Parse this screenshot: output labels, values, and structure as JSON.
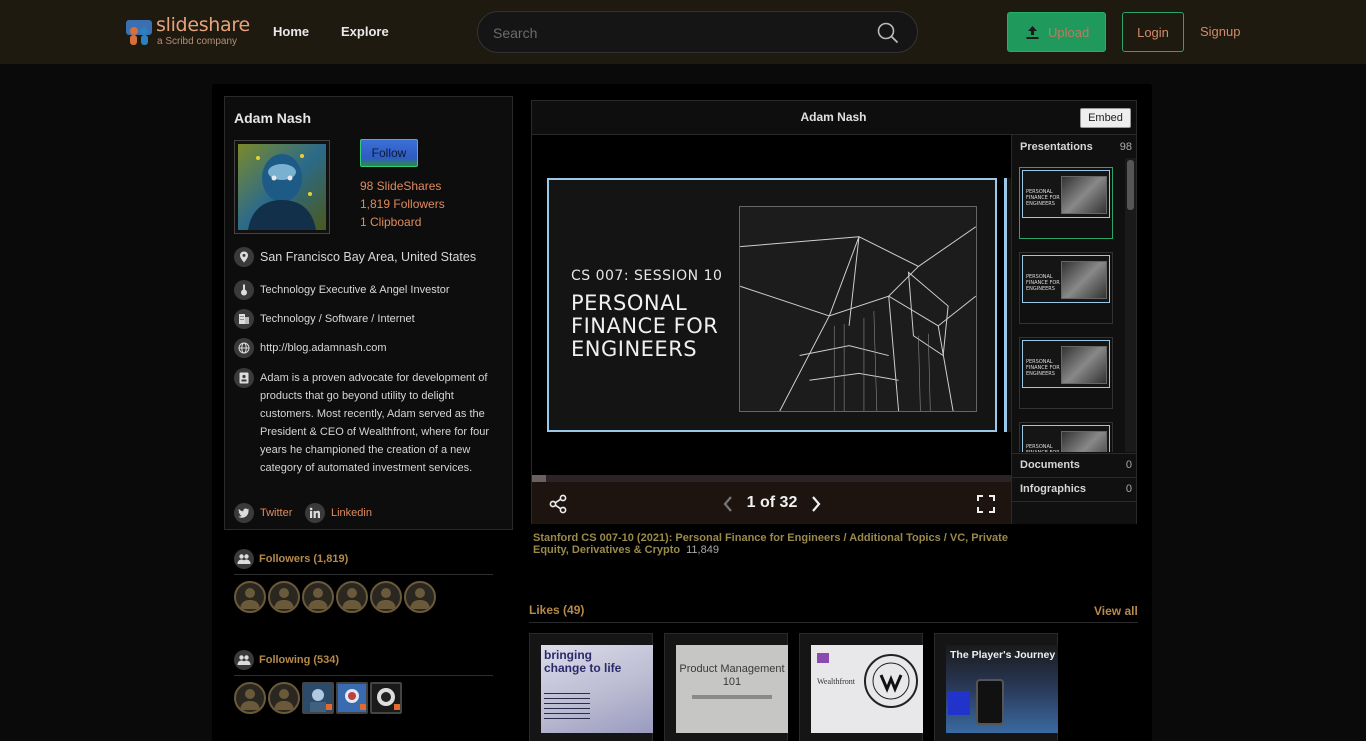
{
  "header": {
    "logo_text": "slideshare",
    "logo_sub": "a Scribd company",
    "nav": [
      "Home",
      "Explore"
    ],
    "search_placeholder": "Search",
    "upload_label": "Upload",
    "login_label": "Login",
    "signup_label": "Signup"
  },
  "profile": {
    "name": "Adam Nash",
    "follow_label": "Follow",
    "stats": [
      "98 SlideShares",
      "1,819 Followers",
      "1 Clipboard"
    ],
    "location": "San Francisco Bay Area, United States",
    "title": "Technology Executive & Angel Investor",
    "industry": "Technology / Software / Internet",
    "website": "http://blog.adamnash.com",
    "about": "Adam is a proven advocate for development of products that go beyond utility to delight customers. Most recently, Adam served as the President & CEO of Wealthfront, where for four years he championed the creation of a new category of automated investment services.",
    "social": [
      "Twitter",
      "Linkedin"
    ]
  },
  "followers": {
    "title": "Followers (1,819)"
  },
  "following": {
    "title": "Following (534)"
  },
  "viewer": {
    "title": "Adam Nash",
    "embed_label": "Embed",
    "slide_kicker": "CS 007: SESSION 10",
    "slide_heading": "PERSONAL FINANCE FOR ENGINEERS",
    "page_indicator": "1 of 32",
    "progress_fraction": 0.03
  },
  "sidebar": {
    "presentations_label": "Presentations",
    "presentations_count": "98",
    "documents_label": "Documents",
    "documents_count": "0",
    "infographics_label": "Infographics",
    "infographics_count": "0",
    "thumb_text": "PERSONAL FINANCE FOR ENGINEERS"
  },
  "deck": {
    "title": "Stanford CS 007-10 (2021): Personal Finance for Engineers / Additional Topics / VC, Private Equity, Derivatives & Crypto",
    "views": "11,849"
  },
  "likes": {
    "title": "Likes (49)",
    "view_all": "View all",
    "cards": [
      "bringing change to life",
      "Product Management 101",
      "Wealthfront",
      "The Player's Journey"
    ]
  },
  "colors": {
    "accent_green": "#1f9a5c",
    "link_orange": "#e08a5e",
    "section_gold": "#b58a4a"
  }
}
